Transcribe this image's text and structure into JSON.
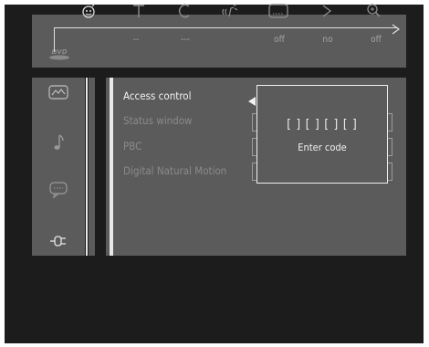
{
  "top_bar": {
    "icons": [
      "person-icon",
      "text-icon",
      "chapter-icon",
      "audio-wave-icon",
      "subtitle-icon",
      "angle-icon",
      "zoom-icon"
    ],
    "values": [
      "--",
      "---",
      "off",
      "no",
      "off"
    ],
    "logo_text": "DVD"
  },
  "sidebar": {
    "icons": [
      "picture-icon",
      "music-note-icon",
      "speech-bubble-icon",
      "plug-icon"
    ]
  },
  "menu": {
    "items": [
      {
        "label": "Access control",
        "active": true
      },
      {
        "label": "Status window",
        "active": false
      },
      {
        "label": "PBC",
        "active": false
      },
      {
        "label": "Digital Natural Motion",
        "active": false
      }
    ]
  },
  "popup": {
    "code_display": "[ ] [ ] [ ] [ ]",
    "label": "Enter code"
  },
  "colors": {
    "panel": "#5b5b5b",
    "background": "#1c1c1c",
    "highlight": "#f2f2f2",
    "dim_text": "#8b8b8b"
  }
}
